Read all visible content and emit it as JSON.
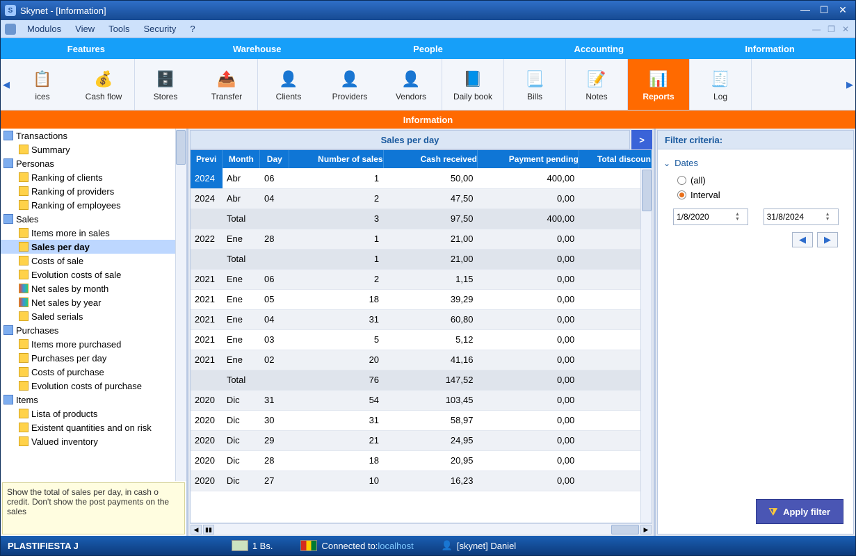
{
  "title": "Skynet - [Information]",
  "menus": [
    "Modulos",
    "View",
    "Tools",
    "Security",
    "?"
  ],
  "tabs": [
    "Features",
    "Warehouse",
    "People",
    "Accounting",
    "Information"
  ],
  "ribbon": [
    {
      "label": "ices",
      "icon": "📋"
    },
    {
      "label": "Cash flow",
      "icon": "💰"
    },
    {
      "label": "Stores",
      "icon": "🗄️"
    },
    {
      "label": "Transfer",
      "icon": "📤"
    },
    {
      "label": "Clients",
      "icon": "👤",
      "color": "#55c23a"
    },
    {
      "label": "Providers",
      "icon": "👤",
      "color": "#2d7dd2"
    },
    {
      "label": "Vendors",
      "icon": "👤",
      "color": "#e7a11a"
    },
    {
      "label": "Daily book",
      "icon": "📘"
    },
    {
      "label": "Bills",
      "icon": "📃"
    },
    {
      "label": "Notes",
      "icon": "📝"
    },
    {
      "label": "Reports",
      "icon": "📊",
      "active": true
    },
    {
      "label": "Log",
      "icon": "🧾"
    }
  ],
  "section_title": "Information",
  "tree": [
    {
      "type": "cat",
      "label": "Transactions"
    },
    {
      "type": "leaf",
      "label": "Summary"
    },
    {
      "type": "cat",
      "label": "Personas"
    },
    {
      "type": "leaf",
      "label": "Ranking of clients"
    },
    {
      "type": "leaf",
      "label": "Ranking of providers"
    },
    {
      "type": "leaf",
      "label": "Ranking of employees"
    },
    {
      "type": "cat",
      "label": "Sales"
    },
    {
      "type": "leaf",
      "label": "Items more in sales"
    },
    {
      "type": "leaf",
      "label": "Sales per day",
      "selected": true
    },
    {
      "type": "leaf",
      "label": "Costs of sale"
    },
    {
      "type": "leaf",
      "label": "Evolution costs of sale"
    },
    {
      "type": "leaf",
      "label": "Net sales by month",
      "chart": true
    },
    {
      "type": "leaf",
      "label": "Net sales by year",
      "chart": true
    },
    {
      "type": "leaf",
      "label": "Saled serials"
    },
    {
      "type": "cat",
      "label": "Purchases"
    },
    {
      "type": "leaf",
      "label": "Items more purchased"
    },
    {
      "type": "leaf",
      "label": "Purchases per day"
    },
    {
      "type": "leaf",
      "label": "Costs of purchase"
    },
    {
      "type": "leaf",
      "label": "Evolution costs of purchase"
    },
    {
      "type": "cat",
      "label": "Items"
    },
    {
      "type": "leaf",
      "label": "Lista of products"
    },
    {
      "type": "leaf",
      "label": "Existent quantities and on risk"
    },
    {
      "type": "leaf",
      "label": "Valued inventory"
    }
  ],
  "hint": "Show the total of sales per day, in cash o credit. Don't show the post payments on the sales",
  "grid": {
    "title": "Sales per day",
    "collapse_btn": ">",
    "cols": [
      "Previ",
      "Month",
      "Day",
      "Number of sales",
      "Cash received",
      "Payment pending",
      "Total discoun"
    ],
    "rows": [
      {
        "y": "2024",
        "m": "Abr",
        "d": "06",
        "n": "1",
        "c": "50,00",
        "p": "400,00",
        "sel": true
      },
      {
        "y": "2024",
        "m": "Abr",
        "d": "04",
        "n": "2",
        "c": "47,50",
        "p": "0,00"
      },
      {
        "total": true,
        "m": "Total",
        "n": "3",
        "c": "97,50",
        "p": "400,00"
      },
      {
        "y": "2022",
        "m": "Ene",
        "d": "28",
        "n": "1",
        "c": "21,00",
        "p": "0,00"
      },
      {
        "total": true,
        "m": "Total",
        "n": "1",
        "c": "21,00",
        "p": "0,00"
      },
      {
        "y": "2021",
        "m": "Ene",
        "d": "06",
        "n": "2",
        "c": "1,15",
        "p": "0,00"
      },
      {
        "y": "2021",
        "m": "Ene",
        "d": "05",
        "n": "18",
        "c": "39,29",
        "p": "0,00"
      },
      {
        "y": "2021",
        "m": "Ene",
        "d": "04",
        "n": "31",
        "c": "60,80",
        "p": "0,00"
      },
      {
        "y": "2021",
        "m": "Ene",
        "d": "03",
        "n": "5",
        "c": "5,12",
        "p": "0,00"
      },
      {
        "y": "2021",
        "m": "Ene",
        "d": "02",
        "n": "20",
        "c": "41,16",
        "p": "0,00"
      },
      {
        "total": true,
        "m": "Total",
        "n": "76",
        "c": "147,52",
        "p": "0,00"
      },
      {
        "y": "2020",
        "m": "Dic",
        "d": "31",
        "n": "54",
        "c": "103,45",
        "p": "0,00"
      },
      {
        "y": "2020",
        "m": "Dic",
        "d": "30",
        "n": "31",
        "c": "58,97",
        "p": "0,00"
      },
      {
        "y": "2020",
        "m": "Dic",
        "d": "29",
        "n": "21",
        "c": "24,95",
        "p": "0,00"
      },
      {
        "y": "2020",
        "m": "Dic",
        "d": "28",
        "n": "18",
        "c": "20,95",
        "p": "0,00"
      },
      {
        "y": "2020",
        "m": "Dic",
        "d": "27",
        "n": "10",
        "c": "16,23",
        "p": "0,00"
      }
    ]
  },
  "filter": {
    "title": "Filter criteria:",
    "section": "Dates",
    "all": "(all)",
    "interval": "Interval",
    "from": "1/8/2020",
    "to": "31/8/2024",
    "apply": "Apply filter"
  },
  "status": {
    "company": "PLASTIFIESTA J",
    "rate": "1 Bs.",
    "conn_label": "Connected to: ",
    "conn_host": "localhost",
    "user": "[skynet] Daniel"
  }
}
